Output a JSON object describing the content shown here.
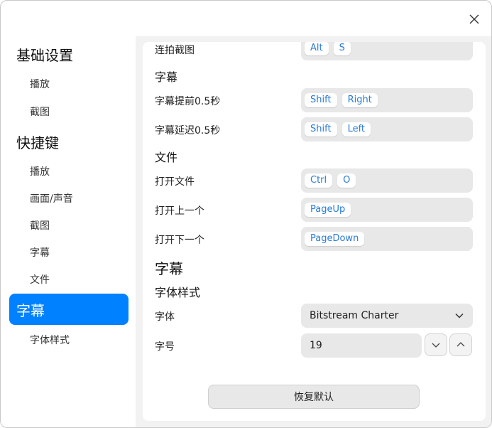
{
  "sidebar": {
    "basic": "基础设置",
    "basic_play": "播放",
    "basic_screenshot": "截图",
    "shortcuts": "快捷键",
    "sc_play": "播放",
    "sc_picture_sound": "画面/声音",
    "sc_screenshot": "截图",
    "sc_subtitle": "字幕",
    "sc_file": "文件",
    "subtitle": "字幕",
    "font_style": "字体样式"
  },
  "shortcuts": {
    "burst": {
      "label": "连拍截图",
      "keys": [
        "Alt",
        "S"
      ]
    },
    "subtitle_section": "字幕",
    "sub_forward": {
      "label": "字幕提前0.5秒",
      "keys": [
        "Shift",
        "Right"
      ]
    },
    "sub_delay": {
      "label": "字幕延迟0.5秒",
      "keys": [
        "Shift",
        "Left"
      ]
    },
    "file_section": "文件",
    "open_file": {
      "label": "打开文件",
      "keys": [
        "Ctrl",
        "O"
      ]
    },
    "open_prev": {
      "label": "打开上一个",
      "keys": [
        "PageUp"
      ]
    },
    "open_next": {
      "label": "打开下一个",
      "keys": [
        "PageDown"
      ]
    }
  },
  "subtitle": {
    "title": "字幕",
    "font_style_title": "字体样式",
    "font_label": "字体",
    "font_value": "Bitstream Charter",
    "size_label": "字号",
    "size_value": "19"
  },
  "footer": {
    "restore_label": "恢复默认"
  },
  "colors": {
    "accent": "#0081ff",
    "key_text": "#2a7bd6"
  },
  "icons": {
    "close": "close-icon",
    "dropdown": "chevron-down-icon",
    "decrease": "chevron-down-icon",
    "increase": "chevron-up-icon"
  }
}
